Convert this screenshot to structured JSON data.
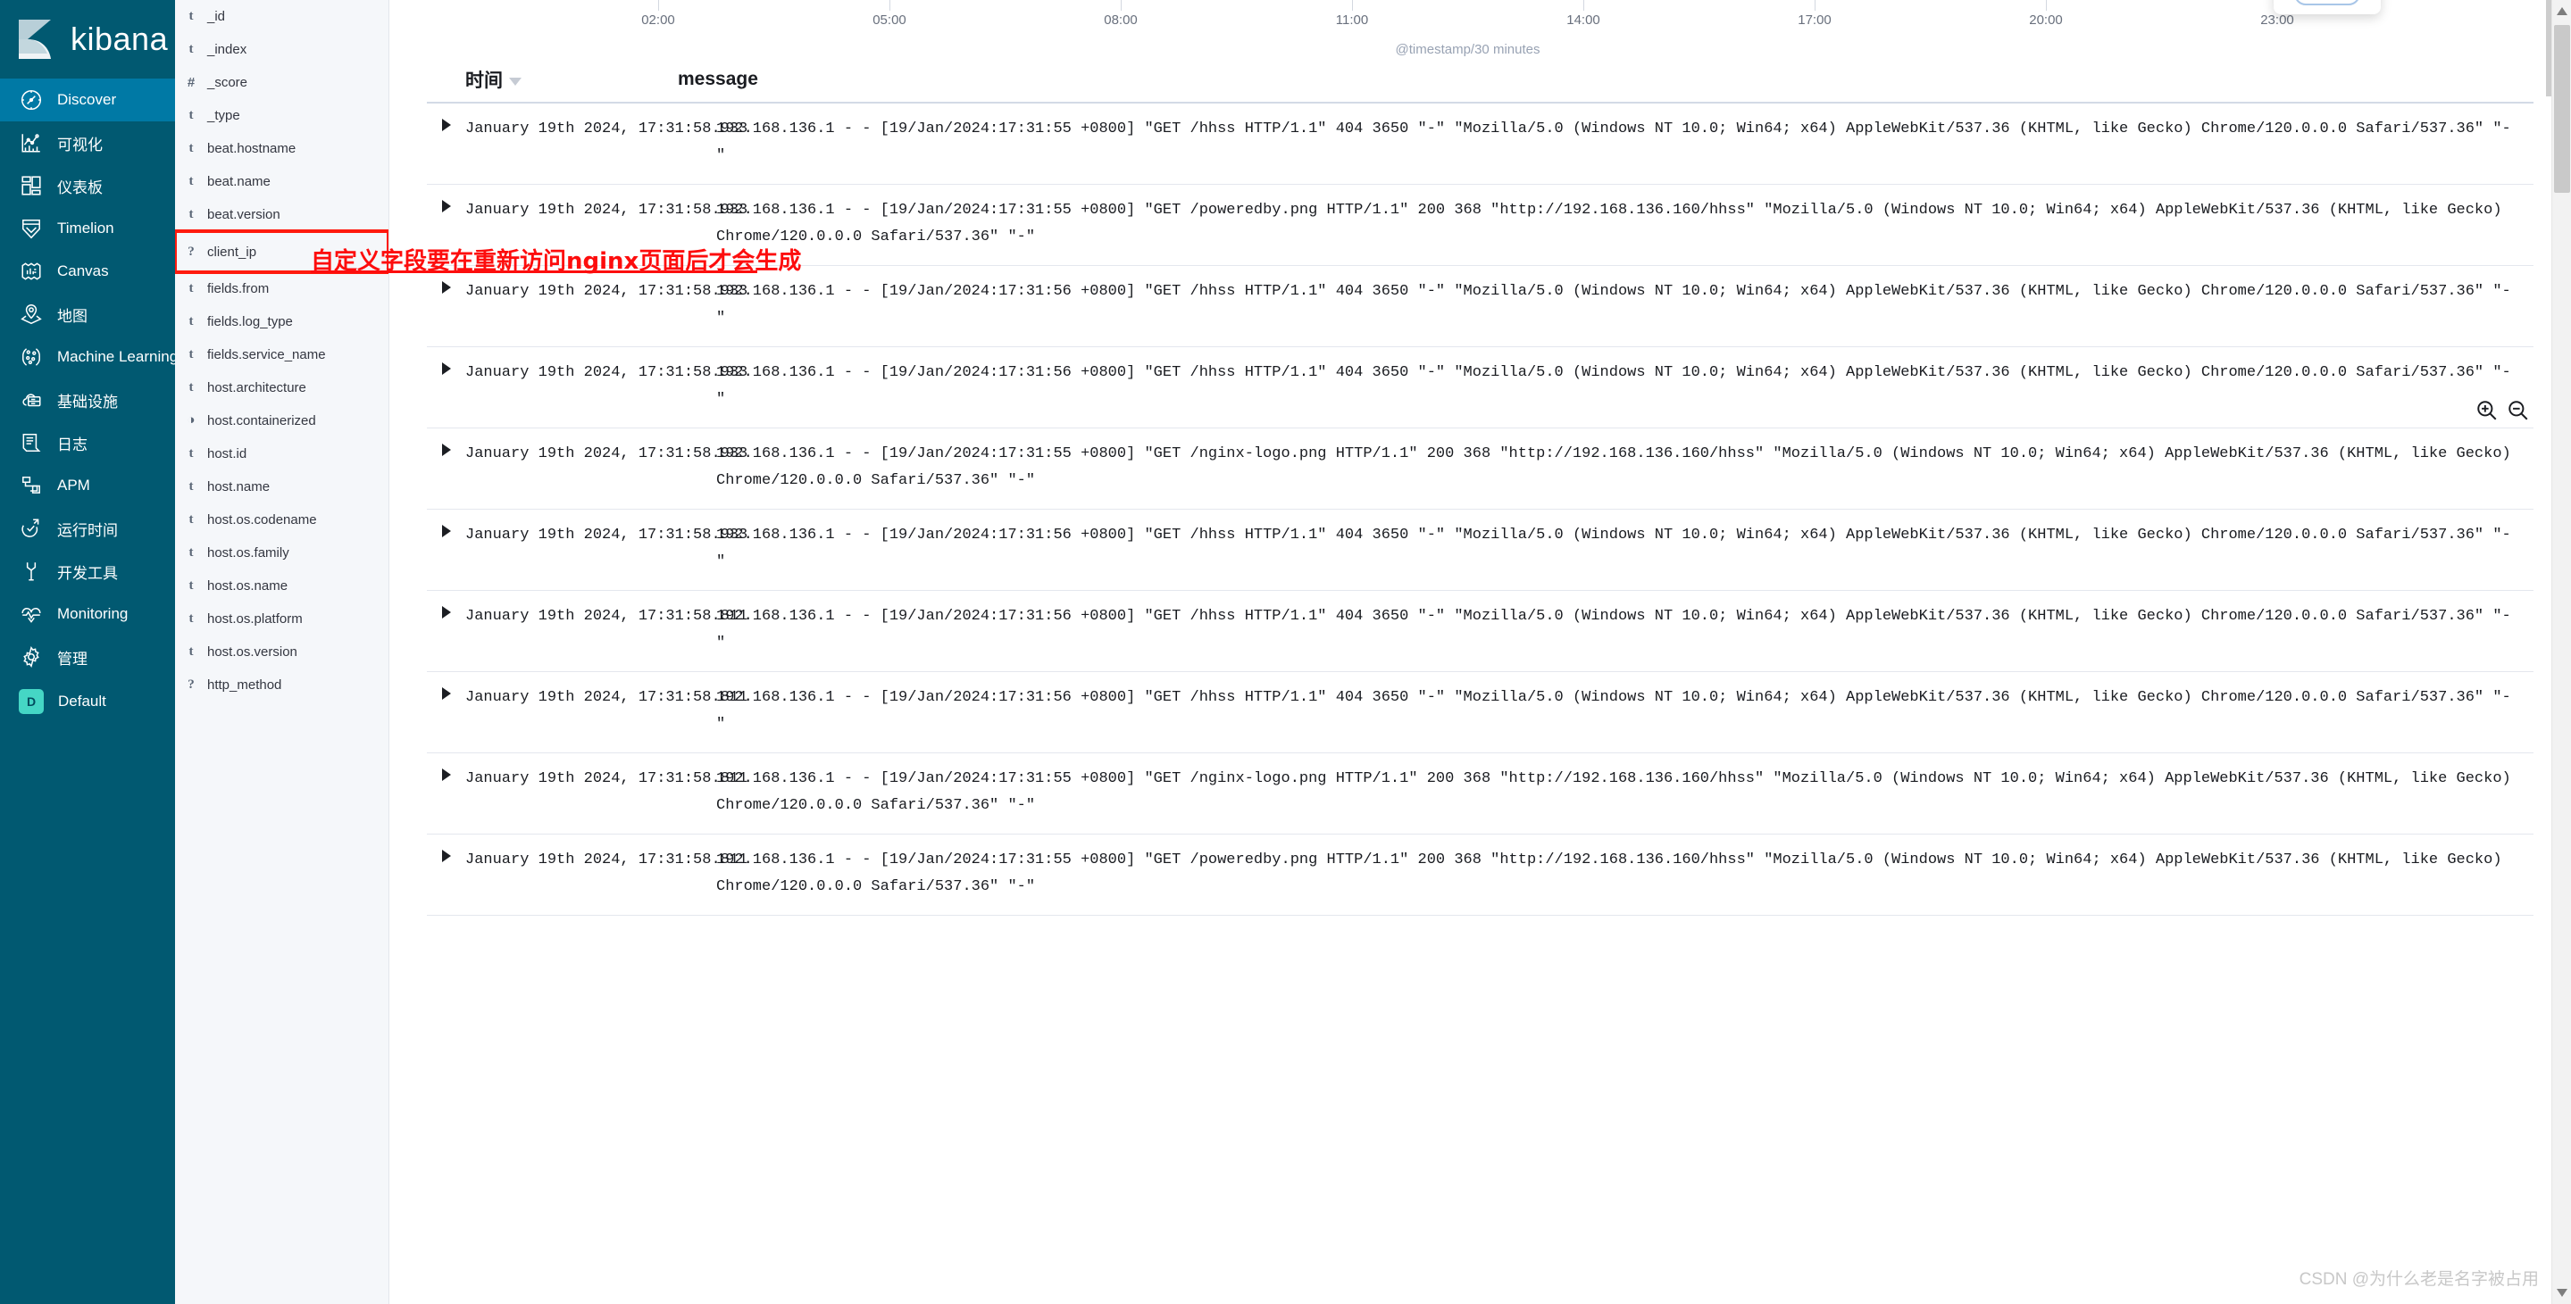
{
  "brand": {
    "name": "kibana",
    "logo_icon": "kibana-logo-icon"
  },
  "sidebar": {
    "items": [
      {
        "label": "Discover",
        "icon": "compass-icon",
        "active": true
      },
      {
        "label": "可视化",
        "icon": "visualize-chart-icon",
        "active": false
      },
      {
        "label": "仪表板",
        "icon": "dashboard-grid-icon",
        "active": false
      },
      {
        "label": "Timelion",
        "icon": "timelion-icon",
        "active": false
      },
      {
        "label": "Canvas",
        "icon": "canvas-frame-icon",
        "active": false
      },
      {
        "label": "地图",
        "icon": "map-pin-layers-icon",
        "active": false
      },
      {
        "label": "Machine Learning",
        "icon": "machine-learning-icon",
        "active": false
      },
      {
        "label": "基础设施",
        "icon": "infrastructure-cloud-icon",
        "active": false
      },
      {
        "label": "日志",
        "icon": "logs-scroll-icon",
        "active": false
      },
      {
        "label": "APM",
        "icon": "apm-icon",
        "active": false
      },
      {
        "label": "运行时间",
        "icon": "uptime-clock-icon",
        "active": false
      },
      {
        "label": "开发工具",
        "icon": "wrench-icon",
        "active": false
      },
      {
        "label": "Monitoring",
        "icon": "heartbeat-icon",
        "active": false
      },
      {
        "label": "管理",
        "icon": "gear-icon",
        "active": false
      }
    ],
    "space": {
      "label": "Default",
      "badge": "D",
      "badge_color": "#45d6c5"
    }
  },
  "field_panel": {
    "fields": [
      {
        "type": "t",
        "name": "_id",
        "highlight": false
      },
      {
        "type": "t",
        "name": "_index",
        "highlight": false
      },
      {
        "type": "#",
        "name": "_score",
        "highlight": false
      },
      {
        "type": "t",
        "name": "_type",
        "highlight": false
      },
      {
        "type": "t",
        "name": "beat.hostname",
        "highlight": false
      },
      {
        "type": "t",
        "name": "beat.name",
        "highlight": false
      },
      {
        "type": "t",
        "name": "beat.version",
        "highlight": false
      },
      {
        "type": "?",
        "name": "client_ip",
        "highlight": true
      },
      {
        "type": "t",
        "name": "fields.from",
        "highlight": false
      },
      {
        "type": "t",
        "name": "fields.log_type",
        "highlight": false
      },
      {
        "type": "t",
        "name": "fields.service_name",
        "highlight": false
      },
      {
        "type": "t",
        "name": "host.architecture",
        "highlight": false
      },
      {
        "type": "◑",
        "name": "host.containerized",
        "highlight": false
      },
      {
        "type": "t",
        "name": "host.id",
        "highlight": false
      },
      {
        "type": "t",
        "name": "host.name",
        "highlight": false
      },
      {
        "type": "t",
        "name": "host.os.codename",
        "highlight": false
      },
      {
        "type": "t",
        "name": "host.os.family",
        "highlight": false
      },
      {
        "type": "t",
        "name": "host.os.name",
        "highlight": false
      },
      {
        "type": "t",
        "name": "host.os.platform",
        "highlight": false
      },
      {
        "type": "t",
        "name": "host.os.version",
        "highlight": false
      },
      {
        "type": "?",
        "name": "http_method",
        "highlight": false
      }
    ]
  },
  "annotation": {
    "text": "自定义字段要在重新访问nginx页面后才会生成",
    "color": "#fd0d0d"
  },
  "chart": {
    "axis_title": "@timestamp/30 minutes",
    "tick_labels": [
      "02:00",
      "05:00",
      "08:00",
      "11:00",
      "14:00",
      "17:00",
      "20:00",
      "23:00"
    ],
    "zoom_in_icon": "zoom-in-icon",
    "zoom_out_icon": "zoom-out-icon"
  },
  "table": {
    "headers": {
      "time": "时间",
      "message": "message"
    },
    "sort_icon": "chevron-down-icon",
    "expand_icon": "triangle-right-icon",
    "rows": [
      {
        "time": "January 19th 2024, 17:31:58.933",
        "message": "192.168.136.1 - - [19/Jan/2024:17:31:55 +0800] \"GET /hhss HTTP/1.1\" 404 3650 \"-\" \"Mozilla/5.0 (Windows NT 10.0; Win64; x64) AppleWebKit/537.36 (KHTML, like Gecko) Chrome/120.0.0.0 Safari/537.36\" \"-\""
      },
      {
        "time": "January 19th 2024, 17:31:58.933",
        "message": "192.168.136.1 - - [19/Jan/2024:17:31:55 +0800] \"GET /poweredby.png HTTP/1.1\" 200 368 \"http://192.168.136.160/hhss\" \"Mozilla/5.0 (Windows NT 10.0; Win64; x64) AppleWebKit/537.36 (KHTML, like Gecko) Chrome/120.0.0.0 Safari/537.36\" \"-\""
      },
      {
        "time": "January 19th 2024, 17:31:58.933",
        "message": "192.168.136.1 - - [19/Jan/2024:17:31:56 +0800] \"GET /hhss HTTP/1.1\" 404 3650 \"-\" \"Mozilla/5.0 (Windows NT 10.0; Win64; x64) AppleWebKit/537.36 (KHTML, like Gecko) Chrome/120.0.0.0 Safari/537.36\" \"-\""
      },
      {
        "time": "January 19th 2024, 17:31:58.933",
        "message": "192.168.136.1 - - [19/Jan/2024:17:31:56 +0800] \"GET /hhss HTTP/1.1\" 404 3650 \"-\" \"Mozilla/5.0 (Windows NT 10.0; Win64; x64) AppleWebKit/537.36 (KHTML, like Gecko) Chrome/120.0.0.0 Safari/537.36\" \"-\""
      },
      {
        "time": "January 19th 2024, 17:31:58.933",
        "message": "192.168.136.1 - - [19/Jan/2024:17:31:55 +0800] \"GET /nginx-logo.png HTTP/1.1\" 200 368 \"http://192.168.136.160/hhss\" \"Mozilla/5.0 (Windows NT 10.0; Win64; x64) AppleWebKit/537.36 (KHTML, like Gecko) Chrome/120.0.0.0 Safari/537.36\" \"-\""
      },
      {
        "time": "January 19th 2024, 17:31:58.933",
        "message": "192.168.136.1 - - [19/Jan/2024:17:31:56 +0800] \"GET /hhss HTTP/1.1\" 404 3650 \"-\" \"Mozilla/5.0 (Windows NT 10.0; Win64; x64) AppleWebKit/537.36 (KHTML, like Gecko) Chrome/120.0.0.0 Safari/537.36\" \"-\""
      },
      {
        "time": "January 19th 2024, 17:31:58.811",
        "message": "192.168.136.1 - - [19/Jan/2024:17:31:56 +0800] \"GET /hhss HTTP/1.1\" 404 3650 \"-\" \"Mozilla/5.0 (Windows NT 10.0; Win64; x64) AppleWebKit/537.36 (KHTML, like Gecko) Chrome/120.0.0.0 Safari/537.36\" \"-\""
      },
      {
        "time": "January 19th 2024, 17:31:58.811",
        "message": "192.168.136.1 - - [19/Jan/2024:17:31:56 +0800] \"GET /hhss HTTP/1.1\" 404 3650 \"-\" \"Mozilla/5.0 (Windows NT 10.0; Win64; x64) AppleWebKit/537.36 (KHTML, like Gecko) Chrome/120.0.0.0 Safari/537.36\" \"-\""
      },
      {
        "time": "January 19th 2024, 17:31:58.811",
        "message": "192.168.136.1 - - [19/Jan/2024:17:31:55 +0800] \"GET /nginx-logo.png HTTP/1.1\" 200 368 \"http://192.168.136.160/hhss\" \"Mozilla/5.0 (Windows NT 10.0; Win64; x64) AppleWebKit/537.36 (KHTML, like Gecko) Chrome/120.0.0.0 Safari/537.36\" \"-\""
      },
      {
        "time": "January 19th 2024, 17:31:58.811",
        "message": "192.168.136.1 - - [19/Jan/2024:17:31:55 +0800] \"GET /poweredby.png HTTP/1.1\" 200 368 \"http://192.168.136.160/hhss\" \"Mozilla/5.0 (Windows NT 10.0; Win64; x64) AppleWebKit/537.36 (KHTML, like Gecko) Chrome/120.0.0.0 Safari/537.36\" \"-\""
      }
    ]
  },
  "watermark": {
    "text": "CSDN @为什么老是名字被占用"
  }
}
